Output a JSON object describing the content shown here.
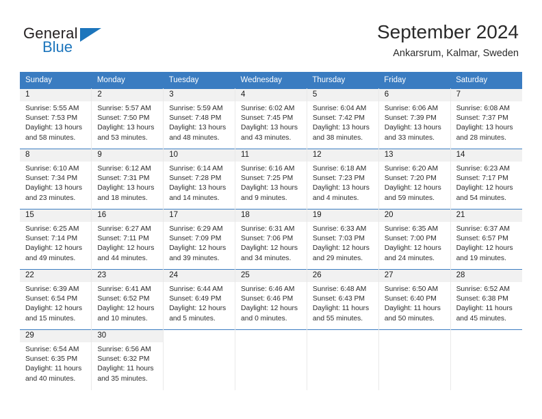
{
  "brand": {
    "name_top": "General",
    "name_bottom": "Blue",
    "color_blue": "#1c75bc",
    "color_dark": "#231f20"
  },
  "header": {
    "month_title": "September 2024",
    "location": "Ankarsrum, Kalmar, Sweden"
  },
  "theme": {
    "header_row_background": "#3a7cc1",
    "header_row_text": "#ffffff",
    "daynum_background": "#f1f1f1",
    "week_border": "#3a7cc1",
    "cell_divider": "#e9e9e9"
  },
  "weekday_headers": [
    "Sunday",
    "Monday",
    "Tuesday",
    "Wednesday",
    "Thursday",
    "Friday",
    "Saturday"
  ],
  "weeks": [
    [
      {
        "day": "1",
        "sunrise": "Sunrise: 5:55 AM",
        "sunset": "Sunset: 7:53 PM",
        "daylight_line1": "Daylight: 13 hours",
        "daylight_line2": "and 58 minutes."
      },
      {
        "day": "2",
        "sunrise": "Sunrise: 5:57 AM",
        "sunset": "Sunset: 7:50 PM",
        "daylight_line1": "Daylight: 13 hours",
        "daylight_line2": "and 53 minutes."
      },
      {
        "day": "3",
        "sunrise": "Sunrise: 5:59 AM",
        "sunset": "Sunset: 7:48 PM",
        "daylight_line1": "Daylight: 13 hours",
        "daylight_line2": "and 48 minutes."
      },
      {
        "day": "4",
        "sunrise": "Sunrise: 6:02 AM",
        "sunset": "Sunset: 7:45 PM",
        "daylight_line1": "Daylight: 13 hours",
        "daylight_line2": "and 43 minutes."
      },
      {
        "day": "5",
        "sunrise": "Sunrise: 6:04 AM",
        "sunset": "Sunset: 7:42 PM",
        "daylight_line1": "Daylight: 13 hours",
        "daylight_line2": "and 38 minutes."
      },
      {
        "day": "6",
        "sunrise": "Sunrise: 6:06 AM",
        "sunset": "Sunset: 7:39 PM",
        "daylight_line1": "Daylight: 13 hours",
        "daylight_line2": "and 33 minutes."
      },
      {
        "day": "7",
        "sunrise": "Sunrise: 6:08 AM",
        "sunset": "Sunset: 7:37 PM",
        "daylight_line1": "Daylight: 13 hours",
        "daylight_line2": "and 28 minutes."
      }
    ],
    [
      {
        "day": "8",
        "sunrise": "Sunrise: 6:10 AM",
        "sunset": "Sunset: 7:34 PM",
        "daylight_line1": "Daylight: 13 hours",
        "daylight_line2": "and 23 minutes."
      },
      {
        "day": "9",
        "sunrise": "Sunrise: 6:12 AM",
        "sunset": "Sunset: 7:31 PM",
        "daylight_line1": "Daylight: 13 hours",
        "daylight_line2": "and 18 minutes."
      },
      {
        "day": "10",
        "sunrise": "Sunrise: 6:14 AM",
        "sunset": "Sunset: 7:28 PM",
        "daylight_line1": "Daylight: 13 hours",
        "daylight_line2": "and 14 minutes."
      },
      {
        "day": "11",
        "sunrise": "Sunrise: 6:16 AM",
        "sunset": "Sunset: 7:25 PM",
        "daylight_line1": "Daylight: 13 hours",
        "daylight_line2": "and 9 minutes."
      },
      {
        "day": "12",
        "sunrise": "Sunrise: 6:18 AM",
        "sunset": "Sunset: 7:23 PM",
        "daylight_line1": "Daylight: 13 hours",
        "daylight_line2": "and 4 minutes."
      },
      {
        "day": "13",
        "sunrise": "Sunrise: 6:20 AM",
        "sunset": "Sunset: 7:20 PM",
        "daylight_line1": "Daylight: 12 hours",
        "daylight_line2": "and 59 minutes."
      },
      {
        "day": "14",
        "sunrise": "Sunrise: 6:23 AM",
        "sunset": "Sunset: 7:17 PM",
        "daylight_line1": "Daylight: 12 hours",
        "daylight_line2": "and 54 minutes."
      }
    ],
    [
      {
        "day": "15",
        "sunrise": "Sunrise: 6:25 AM",
        "sunset": "Sunset: 7:14 PM",
        "daylight_line1": "Daylight: 12 hours",
        "daylight_line2": "and 49 minutes."
      },
      {
        "day": "16",
        "sunrise": "Sunrise: 6:27 AM",
        "sunset": "Sunset: 7:11 PM",
        "daylight_line1": "Daylight: 12 hours",
        "daylight_line2": "and 44 minutes."
      },
      {
        "day": "17",
        "sunrise": "Sunrise: 6:29 AM",
        "sunset": "Sunset: 7:09 PM",
        "daylight_line1": "Daylight: 12 hours",
        "daylight_line2": "and 39 minutes."
      },
      {
        "day": "18",
        "sunrise": "Sunrise: 6:31 AM",
        "sunset": "Sunset: 7:06 PM",
        "daylight_line1": "Daylight: 12 hours",
        "daylight_line2": "and 34 minutes."
      },
      {
        "day": "19",
        "sunrise": "Sunrise: 6:33 AM",
        "sunset": "Sunset: 7:03 PM",
        "daylight_line1": "Daylight: 12 hours",
        "daylight_line2": "and 29 minutes."
      },
      {
        "day": "20",
        "sunrise": "Sunrise: 6:35 AM",
        "sunset": "Sunset: 7:00 PM",
        "daylight_line1": "Daylight: 12 hours",
        "daylight_line2": "and 24 minutes."
      },
      {
        "day": "21",
        "sunrise": "Sunrise: 6:37 AM",
        "sunset": "Sunset: 6:57 PM",
        "daylight_line1": "Daylight: 12 hours",
        "daylight_line2": "and 19 minutes."
      }
    ],
    [
      {
        "day": "22",
        "sunrise": "Sunrise: 6:39 AM",
        "sunset": "Sunset: 6:54 PM",
        "daylight_line1": "Daylight: 12 hours",
        "daylight_line2": "and 15 minutes."
      },
      {
        "day": "23",
        "sunrise": "Sunrise: 6:41 AM",
        "sunset": "Sunset: 6:52 PM",
        "daylight_line1": "Daylight: 12 hours",
        "daylight_line2": "and 10 minutes."
      },
      {
        "day": "24",
        "sunrise": "Sunrise: 6:44 AM",
        "sunset": "Sunset: 6:49 PM",
        "daylight_line1": "Daylight: 12 hours",
        "daylight_line2": "and 5 minutes."
      },
      {
        "day": "25",
        "sunrise": "Sunrise: 6:46 AM",
        "sunset": "Sunset: 6:46 PM",
        "daylight_line1": "Daylight: 12 hours",
        "daylight_line2": "and 0 minutes."
      },
      {
        "day": "26",
        "sunrise": "Sunrise: 6:48 AM",
        "sunset": "Sunset: 6:43 PM",
        "daylight_line1": "Daylight: 11 hours",
        "daylight_line2": "and 55 minutes."
      },
      {
        "day": "27",
        "sunrise": "Sunrise: 6:50 AM",
        "sunset": "Sunset: 6:40 PM",
        "daylight_line1": "Daylight: 11 hours",
        "daylight_line2": "and 50 minutes."
      },
      {
        "day": "28",
        "sunrise": "Sunrise: 6:52 AM",
        "sunset": "Sunset: 6:38 PM",
        "daylight_line1": "Daylight: 11 hours",
        "daylight_line2": "and 45 minutes."
      }
    ],
    [
      {
        "day": "29",
        "sunrise": "Sunrise: 6:54 AM",
        "sunset": "Sunset: 6:35 PM",
        "daylight_line1": "Daylight: 11 hours",
        "daylight_line2": "and 40 minutes."
      },
      {
        "day": "30",
        "sunrise": "Sunrise: 6:56 AM",
        "sunset": "Sunset: 6:32 PM",
        "daylight_line1": "Daylight: 11 hours",
        "daylight_line2": "and 35 minutes."
      },
      {
        "day": "",
        "sunrise": "",
        "sunset": "",
        "daylight_line1": "",
        "daylight_line2": ""
      },
      {
        "day": "",
        "sunrise": "",
        "sunset": "",
        "daylight_line1": "",
        "daylight_line2": ""
      },
      {
        "day": "",
        "sunrise": "",
        "sunset": "",
        "daylight_line1": "",
        "daylight_line2": ""
      },
      {
        "day": "",
        "sunrise": "",
        "sunset": "",
        "daylight_line1": "",
        "daylight_line2": ""
      },
      {
        "day": "",
        "sunrise": "",
        "sunset": "",
        "daylight_line1": "",
        "daylight_line2": ""
      }
    ]
  ]
}
